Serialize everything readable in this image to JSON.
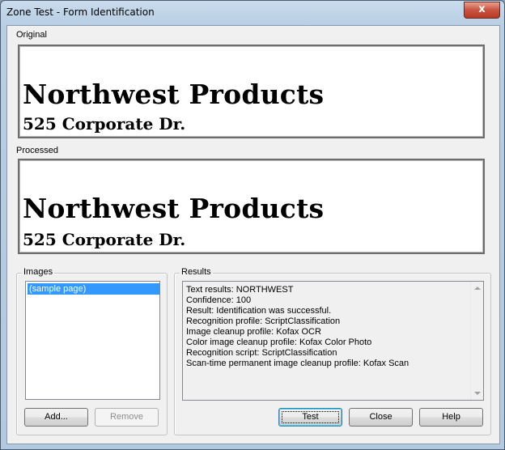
{
  "window": {
    "title": "Zone Test - Form Identification",
    "close_glyph": "x"
  },
  "original": {
    "label": "Original",
    "line1": "Northwest Products",
    "line2": "525 Corporate Dr."
  },
  "processed": {
    "label": "Processed",
    "line1": "Northwest Products",
    "line2": "525 Corporate Dr."
  },
  "images": {
    "label": "Images",
    "items": [
      "(sample page)"
    ],
    "selected_index": 0,
    "add_label": "Add...",
    "remove_label": "Remove"
  },
  "results": {
    "label": "Results",
    "lines": [
      "Text results: NORTHWEST",
      "Confidence: 100",
      "Result: Identification was successful.",
      "Recognition profile: ScriptClassification",
      "Image cleanup profile: Kofax OCR",
      "Color image cleanup profile: Kofax Color Photo",
      "Recognition script: ScriptClassification",
      "Scan-time permanent image cleanup profile: Kofax Scan"
    ]
  },
  "buttons": {
    "test_label": "Test",
    "close_label": "Close",
    "help_label": "Help"
  },
  "colors": {
    "selection": "#3399ff",
    "dialog_bg": "#f0f0f0",
    "close_button": "#c9533f"
  }
}
